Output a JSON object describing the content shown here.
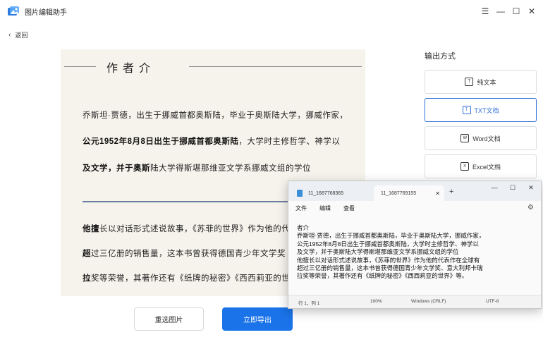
{
  "app": {
    "title": "图片编辑助手",
    "back_label": "返回",
    "window_controls": [
      "minimize-icon",
      "maximize-icon",
      "close-icon"
    ]
  },
  "preview": {
    "heading": "作者介",
    "lines": [
      {
        "text": "乔斯坦·贾德，出生于挪威首都奥斯陆，毕业于奥斯陆大学，挪威作家，"
      },
      {
        "bold": "公元1952年8月8日出生于挪威首都奥斯陆",
        "rest": "，大学时主修哲学、神学以"
      },
      {
        "bold": "及文学，并于奥斯",
        "rest": "陆大学得斯堪那维亚文学系挪威文组的学位"
      },
      {
        "bold": "他擅",
        "rest": "长以对话形式述说故事，《苏菲的世界》作为他的代"
      },
      {
        "bold": "超",
        "rest": "过三亿册的销售量，这本书曾获得德国青少年文学奖"
      },
      {
        "bold": "拉",
        "rest": "奖等荣誉，其著作还有《纸牌的秘密》《西西莉亚的世"
      }
    ]
  },
  "buttons": {
    "reselect": "重选图片",
    "export": "立即导出"
  },
  "output": {
    "title": "输出方式",
    "options": [
      {
        "label": "纯文本",
        "icon": "text-icon",
        "selected": false
      },
      {
        "label": "TXT文档",
        "icon": "txt-file-icon",
        "selected": true
      },
      {
        "label": "Word文档",
        "icon": "word-icon",
        "selected": false
      },
      {
        "label": "Excel文档",
        "icon": "excel-icon",
        "selected": false
      }
    ]
  },
  "notepad": {
    "tabs": [
      {
        "label": "11_1687768365",
        "active": false
      },
      {
        "label": "11_1687769155",
        "active": true
      }
    ],
    "menu": [
      "文件",
      "编辑",
      "查看"
    ],
    "content": [
      "者介",
      "乔斯坦·贾德，出生于挪威首都奥斯陆，毕业于奥斯陆大学，挪威作家，",
      "公元1952年8月8日出生于挪威首都奥斯陆，大学时主修哲学、神学以",
      "及文学，并于奥斯陆大学得斯堪那维亚文学系挪威文组的学位",
      "他擅长以对话形式述说故事，《苏菲的世界》作为他的代表作在全球有",
      "超过三亿册的销售量，这本书曾获得德国青少年文学奖、意大利邦卡瑞",
      "拉奖等荣誉，其著作还有《纸牌的秘密》《西西莉亚的世界》等。"
    ],
    "status": {
      "position": "行 1，列 1",
      "zoom": "100%",
      "line_ending": "Windows (CRLF)",
      "encoding": "UTF-8"
    }
  },
  "colors": {
    "accent": "#1a73e8",
    "selected_border": "#2f6fd6"
  }
}
